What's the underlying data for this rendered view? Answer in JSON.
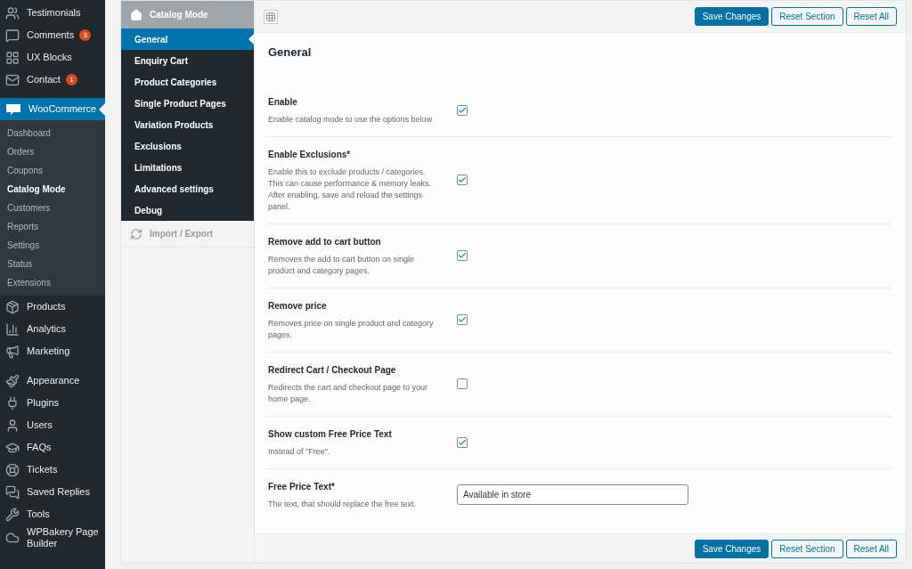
{
  "admin_menu": {
    "groups": [
      [
        {
          "label": "Testimonials",
          "selected": false
        },
        {
          "label": "Comments",
          "badge": "3",
          "selected": false
        },
        {
          "label": "UX Blocks",
          "selected": false
        },
        {
          "label": "Contact",
          "badge": "1",
          "selected": false
        }
      ],
      [
        {
          "label": "WooCommerce",
          "selected": true,
          "children": [
            {
              "label": "Dashboard",
              "selected": false
            },
            {
              "label": "Orders",
              "selected": false
            },
            {
              "label": "Coupons",
              "selected": false
            },
            {
              "label": "Catalog Mode",
              "selected": true
            },
            {
              "label": "Customers",
              "selected": false
            },
            {
              "label": "Reports",
              "selected": false
            },
            {
              "label": "Settings",
              "selected": false
            },
            {
              "label": "Status",
              "selected": false
            },
            {
              "label": "Extensions",
              "selected": false
            }
          ]
        },
        {
          "label": "Products",
          "selected": false
        },
        {
          "label": "Analytics",
          "selected": false
        },
        {
          "label": "Marketing",
          "selected": false
        }
      ],
      [
        {
          "label": "Appearance",
          "selected": false
        },
        {
          "label": "Plugins",
          "selected": false
        },
        {
          "label": "Users",
          "selected": false
        },
        {
          "label": "FAQs",
          "selected": false
        },
        {
          "label": "Tickets",
          "selected": false
        },
        {
          "label": "Saved Replies",
          "selected": false
        },
        {
          "label": "Tools",
          "selected": false
        },
        {
          "label": "WPBakery Page Builder",
          "selected": false
        }
      ]
    ]
  },
  "options_panel": {
    "title": "Catalog Mode",
    "sections": [
      {
        "label": "General",
        "selected": true
      },
      {
        "label": "Enquiry Cart",
        "selected": false
      },
      {
        "label": "Product Categories",
        "selected": false
      },
      {
        "label": "Single Product Pages",
        "selected": false
      },
      {
        "label": "Variation Products",
        "selected": false
      },
      {
        "label": "Exclusions",
        "selected": false
      },
      {
        "label": "Limitations",
        "selected": false
      },
      {
        "label": "Advanced settings",
        "selected": false
      },
      {
        "label": "Debug",
        "selected": false
      }
    ],
    "import_export": "Import / Export",
    "top_buttons": [
      {
        "label": "Save Changes",
        "primary": true
      },
      {
        "label": "Reset Section",
        "primary": false
      },
      {
        "label": "Reset All",
        "primary": false
      }
    ],
    "heading": "General",
    "fields": [
      {
        "kind": "checkbox",
        "label": "Enable",
        "description": "Enable catalog mode to use the options below",
        "checked": true
      },
      {
        "kind": "checkbox",
        "label": "Enable Exclusions*",
        "description": "Enable this to exclude products / categories. This can cause performance & memory leaks. After enabling, save and reload the settings panel.",
        "checked": true
      },
      {
        "kind": "checkbox",
        "label": "Remove add to cart button",
        "description": "Removes the add to cart button on single product and category pages.",
        "checked": true
      },
      {
        "kind": "checkbox",
        "label": "Remove price",
        "description": "Removes price on single product and category pages.",
        "checked": true
      },
      {
        "kind": "checkbox",
        "label": "Redirect Cart / Checkout Page",
        "description": "Redirects the cart and checkout page to your home page.",
        "checked": false
      },
      {
        "kind": "checkbox",
        "label": "Show custom Free Price Text",
        "description": "Instead of \"Free\".",
        "checked": true
      },
      {
        "kind": "text",
        "label": "Free Price Text*",
        "description": "The text, that should replace the free text.",
        "value": "Available in store"
      }
    ],
    "bottom_buttons": [
      {
        "label": "Save Changes",
        "primary": true
      },
      {
        "label": "Reset Section",
        "primary": false
      },
      {
        "label": "Reset All",
        "primary": false
      }
    ]
  }
}
